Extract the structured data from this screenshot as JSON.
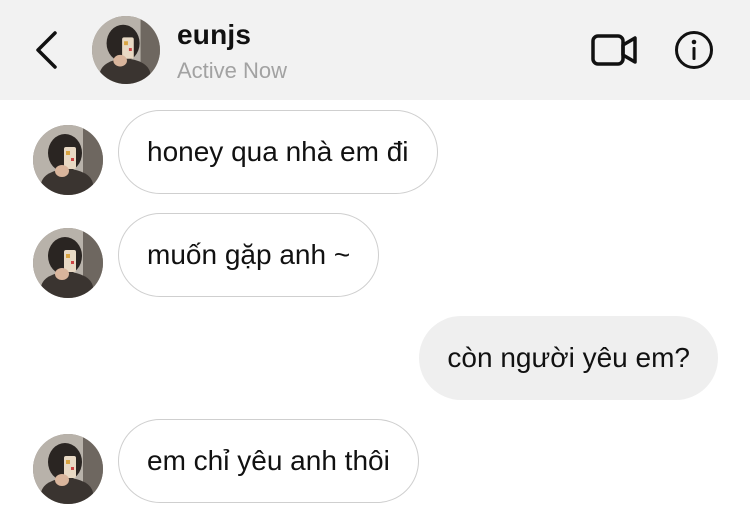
{
  "header": {
    "username": "eunjs",
    "status": "Active Now",
    "back_icon": "chevron-left-icon",
    "video_icon": "video-camera-icon",
    "info_icon": "info-icon",
    "background": "#f2f2f2"
  },
  "messages": [
    {
      "direction": "incoming",
      "text": "honey qua nhà em đi"
    },
    {
      "direction": "incoming",
      "text": "muốn gặp anh ~"
    },
    {
      "direction": "outgoing",
      "text": "còn người yêu em?"
    },
    {
      "direction": "incoming",
      "text": "em chỉ yêu anh thôi"
    }
  ],
  "colors": {
    "incoming_bubble_border": "#cfcfcf",
    "outgoing_bubble_fill": "#efefef",
    "status_text": "#a2a2a2"
  }
}
